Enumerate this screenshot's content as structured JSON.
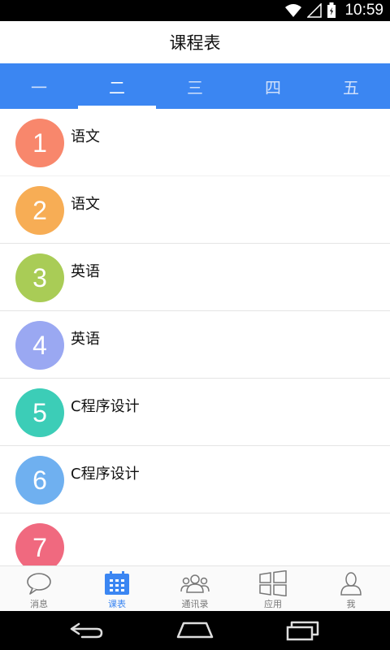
{
  "status_bar": {
    "time": "10:59",
    "icons": [
      "wifi-icon",
      "signal-icon",
      "battery-icon"
    ]
  },
  "title": "课程表",
  "accent_color": "#3b86f2",
  "day_tabs": [
    {
      "label": "一",
      "active": false
    },
    {
      "label": "二",
      "active": true
    },
    {
      "label": "三",
      "active": false
    },
    {
      "label": "四",
      "active": false
    },
    {
      "label": "五",
      "active": false
    }
  ],
  "courses": [
    {
      "number": "1",
      "name": "语文",
      "color": "#f8876c"
    },
    {
      "number": "2",
      "name": "语文",
      "color": "#f7ad55"
    },
    {
      "number": "3",
      "name": "英语",
      "color": "#a9cc56"
    },
    {
      "number": "4",
      "name": "英语",
      "color": "#9aa8f2"
    },
    {
      "number": "5",
      "name": "C程序设计",
      "color": "#3ccdb7"
    },
    {
      "number": "6",
      "name": "C程序设计",
      "color": "#6fb0f0"
    },
    {
      "number": "7",
      "name": "",
      "color": "#f0697f"
    }
  ],
  "bottom_nav": [
    {
      "label": "消息",
      "icon": "chat-bubble-icon",
      "active": false
    },
    {
      "label": "课表",
      "icon": "calendar-grid-icon",
      "active": true
    },
    {
      "label": "通讯录",
      "icon": "contacts-icon",
      "active": false
    },
    {
      "label": "应用",
      "icon": "apps-window-icon",
      "active": false
    },
    {
      "label": "我",
      "icon": "person-icon",
      "active": false
    }
  ],
  "android_nav": [
    "back-icon",
    "home-icon",
    "recents-icon"
  ]
}
